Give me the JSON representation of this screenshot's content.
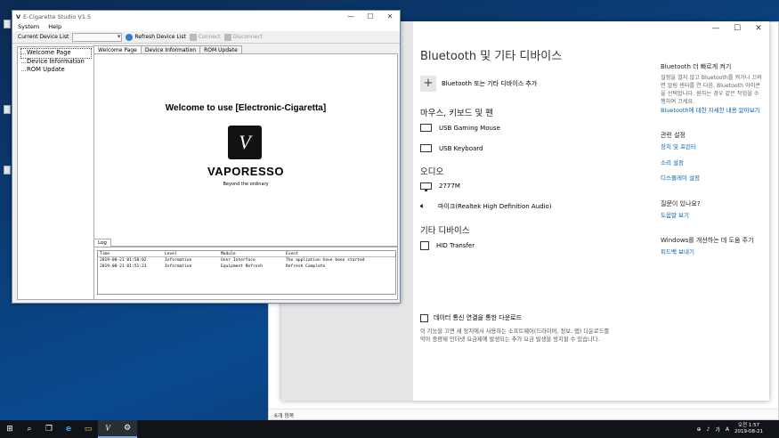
{
  "desktop": {
    "icon_count": 3
  },
  "explorer": {
    "status_text": "6개 항목"
  },
  "settings": {
    "title": "Bluetooth 및 기타 디바이스",
    "caption": {
      "minimize": "—",
      "maximize": "☐",
      "close": "✕"
    },
    "add_device_label": "Bluetooth 또는 기타 디바이스 추가",
    "sections": [
      {
        "heading": "마우스, 키보드 및 펜",
        "devices": [
          {
            "name": "USB Gaming Mouse",
            "icon": "keyboard-icon"
          },
          {
            "name": "USB Keyboard",
            "icon": "keyboard-icon"
          }
        ]
      },
      {
        "heading": "오디오",
        "devices": [
          {
            "name": "2777M",
            "icon": "monitor-icon"
          },
          {
            "name": "마이크(Realtek High Definition Audio)",
            "icon": "speaker-icon"
          }
        ]
      },
      {
        "heading": "기타 디바이스",
        "devices": [
          {
            "name": "HID Transfer",
            "icon": "hid-device-icon"
          }
        ]
      }
    ],
    "metered": {
      "checkbox_label": "데이터 통신 연결을 통한 다운로드",
      "description": "이 기능을 끄면 새 장치에서 사용하는 소프트웨어(드라이버, 정보, 앱) 다운로드를 막아 종량제 인터넷 요금제에 발생되는 추가 요금 발생을 방지할 수 있습니다."
    },
    "right": {
      "quick_heading": "Bluetooth 더 빠르게 켜기",
      "quick_text": "설정을 열지 않고 Bluetooth를 켜거나 끄려면 알림 센터를 연 다음, Bluetooth 아이콘을 선택합니다. 원하는 경우 같은 작업을 수행하여 끄세요.",
      "quick_link": "Bluetooth에 대한 자세한 내용 알아보기",
      "related_heading": "관련 설정",
      "related_links": [
        "장치 및 프린터",
        "소리 설정",
        "디스플레이 설정"
      ],
      "help_heading": "질문이 있나요?",
      "help_link": "도움말 보기",
      "improve_heading": "Windows를 개선하는 데 도움 주기",
      "improve_link": "피드백 보내기"
    }
  },
  "app": {
    "title": "E-Cigarette Studio V1.5",
    "logo_glyph": "V",
    "caption": {
      "minimize": "—",
      "maximize": "☐",
      "close": "✕"
    },
    "menu": [
      "System",
      "Help"
    ],
    "toolbar": {
      "device_list_label": "Current Device List",
      "refresh_label": "Refresh Device List",
      "connect_label": "Connect",
      "disconnect_label": "Disconnect"
    },
    "tree": [
      "Welcome Page",
      "Device Information",
      "ROM Update"
    ],
    "tabs": [
      "Welcome Page",
      "Device Information",
      "ROM Update"
    ],
    "welcome_text": "Welcome to use [Electronic-Cigaretta]",
    "brand_glyph": "V",
    "brand": "VAPORESSO",
    "tagline": "Beyond the ordinary",
    "log_tab": "Log",
    "log_headers": [
      "Time",
      "Level",
      "Module",
      "Event"
    ],
    "log_rows": [
      [
        "2019-08-21 01:58:02",
        "Information",
        "User Interface",
        "The appliation have been started"
      ],
      [
        "2019-08-21 01:51:23",
        "Information",
        "Equipment Refresh",
        "Refresh Complete"
      ]
    ]
  },
  "taskbar": {
    "items": [
      {
        "name": "start-button",
        "glyph": "⊞"
      },
      {
        "name": "search-button",
        "glyph": "⌕"
      },
      {
        "name": "task-view-button",
        "glyph": "❐"
      },
      {
        "name": "edge-button",
        "glyph": "e"
      },
      {
        "name": "file-explorer-button",
        "glyph": "▭"
      },
      {
        "name": "vaporesso-app-button",
        "glyph": "V"
      },
      {
        "name": "settings-app-button",
        "glyph": "⚙"
      }
    ],
    "tray": {
      "network": "⊕",
      "volume": "♪",
      "lang1": "가",
      "lang2": "A",
      "time": "오전 1:57",
      "date": "2019-08-21"
    }
  }
}
